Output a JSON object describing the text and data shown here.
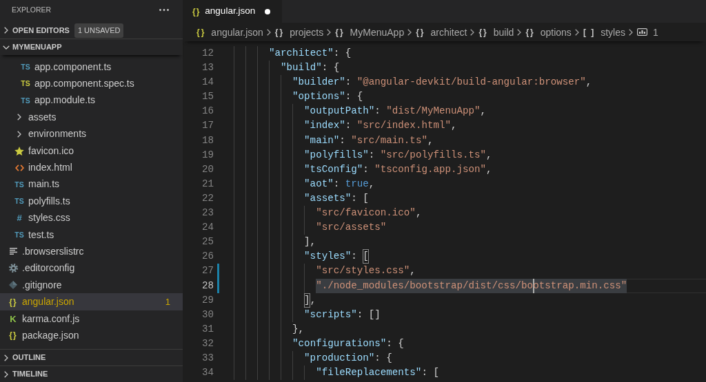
{
  "sidebar": {
    "title": "EXPLORER",
    "sections": [
      {
        "title": "OPEN EDITORS",
        "expanded": false,
        "tag": "1 UNSAVED"
      },
      {
        "title": "MYMENUAPP",
        "expanded": true,
        "items": [
          {
            "children": [
              {
                "children": [
                  {
                    "kind": "typescript",
                    "icon": "TS",
                    "label": "app.component.ts",
                    "selected": false
                  },
                  {
                    "kind": "test",
                    "icon": "TS",
                    "label": "app.component.spec.ts",
                    "selected": false
                  },
                  {
                    "kind": "typescript",
                    "icon": "TS",
                    "label": "app.module.ts",
                    "selected": false
                  }
                ]
              },
              {
                "kind": "folder",
                "label": "assets",
                "expanded": false,
                "selected": false
              },
              {
                "kind": "folder",
                "label": "environments",
                "expanded": false,
                "selected": false
              },
              {
                "kind": "image",
                "label": "favicon.ico",
                "selected": false
              },
              {
                "kind": "html",
                "label": "index.html",
                "selected": false
              },
              {
                "kind": "typescript",
                "icon": "TS",
                "label": "main.ts",
                "selected": false
              },
              {
                "kind": "typescript",
                "icon": "TS",
                "label": "polyfills.ts",
                "selected": false
              },
              {
                "kind": "css",
                "icon": "#",
                "label": "styles.css",
                "selected": false
              },
              {
                "kind": "typescript",
                "icon": "TS",
                "label": "test.ts",
                "selected": false
              }
            ]
          },
          {
            "kind": "config",
            "label": ".browserslistrc",
            "selected": false
          },
          {
            "kind": "settings",
            "label": ".editorconfig",
            "selected": false
          },
          {
            "kind": "git",
            "label": ".gitignore",
            "selected": false
          },
          {
            "kind": "json",
            "icon": "{}",
            "label": "angular.json",
            "selected": true,
            "problems": "1"
          },
          {
            "kind": "karma",
            "icon": "K",
            "label": "karma.conf.js",
            "selected": false
          },
          {
            "kind": "json",
            "icon": "{}",
            "label": "package.json",
            "selected": false
          }
        ]
      },
      {
        "title": "OUTLINE",
        "expanded": false
      },
      {
        "title": "TIMELINE",
        "expanded": false
      }
    ]
  },
  "editor": {
    "tabs": [
      {
        "icon": "{}",
        "label": "angular.json",
        "selected": true,
        "modified": true
      }
    ],
    "breadcrumbs": [
      {
        "kind": "file",
        "icon": "{}",
        "label": "angular.json"
      },
      {
        "kind": "object",
        "icon": "{}",
        "label": "projects"
      },
      {
        "kind": "object",
        "icon": "{}",
        "label": "MyMenuApp"
      },
      {
        "kind": "object",
        "icon": "{}",
        "label": "architect"
      },
      {
        "kind": "object",
        "icon": "{}",
        "label": "build"
      },
      {
        "kind": "object",
        "icon": "{}",
        "label": "options"
      },
      {
        "kind": "array",
        "icon": "[ ]",
        "label": "styles"
      },
      {
        "kind": "string",
        "label": "1"
      }
    ],
    "lines": [
      {
        "children": [
          {
            "children": [
              {
                "children": [
                  {
                    "children": [
                      {
                        "number": "12",
                        "current": false,
                        "modified": false,
                        "tokens": [
                          {
                            "kind": "key",
                            "text": "\"architect\""
                          },
                          {
                            "kind": "punct",
                            "text": ": {"
                          }
                        ],
                        "children": [
                          {
                            "number": "13",
                            "current": false,
                            "modified": false,
                            "tokens": [
                              {
                                "kind": "key",
                                "text": "\"build\""
                              },
                              {
                                "kind": "punct",
                                "text": ": {"
                              }
                            ],
                            "children": [
                              {
                                "number": "14",
                                "current": false,
                                "modified": false,
                                "tokens": [
                                  {
                                    "kind": "key",
                                    "text": "\"builder\""
                                  },
                                  {
                                    "kind": "punct",
                                    "text": ": "
                                  },
                                  {
                                    "kind": "string",
                                    "text": "\"@angular-devkit/build-angular:browser\""
                                  },
                                  {
                                    "kind": "punct",
                                    "text": ","
                                  }
                                ]
                              },
                              {
                                "number": "15",
                                "current": false,
                                "modified": false,
                                "tokens": [
                                  {
                                    "kind": "key",
                                    "text": "\"options\""
                                  },
                                  {
                                    "kind": "punct",
                                    "text": ": {"
                                  }
                                ],
                                "children": [
                                  {
                                    "number": "16",
                                    "current": false,
                                    "modified": false,
                                    "tokens": [
                                      {
                                        "kind": "key",
                                        "text": "\"outputPath\""
                                      },
                                      {
                                        "kind": "punct",
                                        "text": ": "
                                      },
                                      {
                                        "kind": "string",
                                        "text": "\"dist/MyMenuApp\""
                                      },
                                      {
                                        "kind": "punct",
                                        "text": ","
                                      }
                                    ]
                                  },
                                  {
                                    "number": "17",
                                    "current": false,
                                    "modified": false,
                                    "tokens": [
                                      {
                                        "kind": "key",
                                        "text": "\"index\""
                                      },
                                      {
                                        "kind": "punct",
                                        "text": ": "
                                      },
                                      {
                                        "kind": "string",
                                        "text": "\"src/index.html\""
                                      },
                                      {
                                        "kind": "punct",
                                        "text": ","
                                      }
                                    ]
                                  },
                                  {
                                    "number": "18",
                                    "current": false,
                                    "modified": false,
                                    "tokens": [
                                      {
                                        "kind": "key",
                                        "text": "\"main\""
                                      },
                                      {
                                        "kind": "punct",
                                        "text": ": "
                                      },
                                      {
                                        "kind": "string",
                                        "text": "\"src/main.ts\""
                                      },
                                      {
                                        "kind": "punct",
                                        "text": ","
                                      }
                                    ]
                                  },
                                  {
                                    "number": "19",
                                    "current": false,
                                    "modified": false,
                                    "tokens": [
                                      {
                                        "kind": "key",
                                        "text": "\"polyfills\""
                                      },
                                      {
                                        "kind": "punct",
                                        "text": ": "
                                      },
                                      {
                                        "kind": "string",
                                        "text": "\"src/polyfills.ts\""
                                      },
                                      {
                                        "kind": "punct",
                                        "text": ","
                                      }
                                    ]
                                  },
                                  {
                                    "number": "20",
                                    "current": false,
                                    "modified": false,
                                    "tokens": [
                                      {
                                        "kind": "key",
                                        "text": "\"tsConfig\""
                                      },
                                      {
                                        "kind": "punct",
                                        "text": ": "
                                      },
                                      {
                                        "kind": "string",
                                        "text": "\"tsconfig.app.json\""
                                      },
                                      {
                                        "kind": "punct",
                                        "text": ","
                                      }
                                    ]
                                  },
                                  {
                                    "number": "21",
                                    "current": false,
                                    "modified": false,
                                    "tokens": [
                                      {
                                        "kind": "key",
                                        "text": "\"aot\""
                                      },
                                      {
                                        "kind": "punct",
                                        "text": ": "
                                      },
                                      {
                                        "kind": "keyword",
                                        "text": "true"
                                      },
                                      {
                                        "kind": "punct",
                                        "text": ","
                                      }
                                    ]
                                  },
                                  {
                                    "number": "22",
                                    "current": false,
                                    "modified": false,
                                    "tokens": [
                                      {
                                        "kind": "key",
                                        "text": "\"assets\""
                                      },
                                      {
                                        "kind": "punct",
                                        "text": ": ["
                                      }
                                    ],
                                    "children": [
                                      {
                                        "number": "23",
                                        "current": false,
                                        "modified": false,
                                        "tokens": [
                                          {
                                            "kind": "string",
                                            "text": "\"src/favicon.ico\""
                                          },
                                          {
                                            "kind": "punct",
                                            "text": ","
                                          }
                                        ]
                                      },
                                      {
                                        "number": "24",
                                        "current": false,
                                        "modified": false,
                                        "tokens": [
                                          {
                                            "kind": "string",
                                            "text": "\"src/assets\""
                                          }
                                        ]
                                      }
                                    ]
                                  },
                                  {
                                    "number": "25",
                                    "current": false,
                                    "modified": false,
                                    "tokens": [
                                      {
                                        "kind": "punct",
                                        "text": "],"
                                      }
                                    ]
                                  },
                                  {
                                    "number": "26",
                                    "current": false,
                                    "modified": false,
                                    "tokens": [
                                      {
                                        "kind": "key",
                                        "text": "\"styles\""
                                      },
                                      {
                                        "kind": "punct",
                                        "text": ": "
                                      },
                                      {
                                        "kind": "bracket",
                                        "text": "["
                                      }
                                    ],
                                    "children": [
                                      {
                                        "number": "27",
                                        "current": false,
                                        "modified": true,
                                        "tokens": [
                                          {
                                            "kind": "string",
                                            "text": "\"src/styles.css\""
                                          },
                                          {
                                            "kind": "punct",
                                            "text": ","
                                          }
                                        ]
                                      },
                                      {
                                        "number": "28",
                                        "current": true,
                                        "modified": true,
                                        "tokens": [
                                          {
                                            "kind": "highlight",
                                            "text": "\"./node_modules/bootstrap/dist/css/bo"
                                          },
                                          {
                                            "kind": "caret",
                                            "text": "otstrap.min.css\""
                                          }
                                        ]
                                      }
                                    ]
                                  },
                                  {
                                    "number": "29",
                                    "current": false,
                                    "modified": false,
                                    "tokens": [
                                      {
                                        "kind": "bracket",
                                        "text": "]"
                                      },
                                      {
                                        "kind": "punct",
                                        "text": ","
                                      }
                                    ]
                                  },
                                  {
                                    "number": "30",
                                    "current": false,
                                    "modified": false,
                                    "tokens": [
                                      {
                                        "kind": "key",
                                        "text": "\"scripts\""
                                      },
                                      {
                                        "kind": "punct",
                                        "text": ": []"
                                      }
                                    ]
                                  }
                                ]
                              },
                              {
                                "number": "31",
                                "current": false,
                                "modified": false,
                                "tokens": [
                                  {
                                    "kind": "punct",
                                    "text": "},"
                                  }
                                ]
                              },
                              {
                                "number": "32",
                                "current": false,
                                "modified": false,
                                "tokens": [
                                  {
                                    "kind": "key",
                                    "text": "\"configurations\""
                                  },
                                  {
                                    "kind": "punct",
                                    "text": ": {"
                                  }
                                ],
                                "children": [
                                  {
                                    "number": "33",
                                    "current": false,
                                    "modified": false,
                                    "tokens": [
                                      {
                                        "kind": "key",
                                        "text": "\"production\""
                                      },
                                      {
                                        "kind": "punct",
                                        "text": ": {"
                                      }
                                    ],
                                    "children": [
                                      {
                                        "number": "34",
                                        "current": false,
                                        "modified": false,
                                        "tokens": [
                                          {
                                            "kind": "key",
                                            "text": "\"fileReplacements\""
                                          },
                                          {
                                            "kind": "punct",
                                            "text": ": ["
                                          }
                                        ]
                                      }
                                    ]
                                  }
                                ]
                              }
                            ]
                          }
                        ]
                      }
                    ]
                  }
                ]
              }
            ]
          }
        ]
      }
    ]
  }
}
